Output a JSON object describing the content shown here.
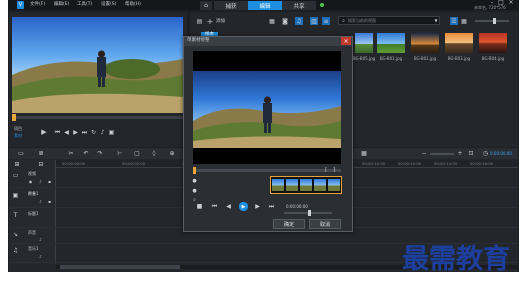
{
  "menu": {
    "items": [
      "文件(F)",
      "编辑(E)",
      "工具(T)",
      "设置(S)",
      "帮助(H)"
    ]
  },
  "window_title": "未命名, 720*576",
  "workspace_tabs": [
    {
      "label": "捕获",
      "active": false
    },
    {
      "label": "编辑",
      "active": true
    },
    {
      "label": "共享",
      "active": false
    }
  ],
  "library": {
    "add_label": "添加",
    "folder_label": "样本",
    "search_placeholder": "搜索当前的视图",
    "thumbnails": [
      "BG-B01.jpg",
      "BG-B02.jpg",
      "BG-B03.jpg",
      "BG-B04.jpg",
      "BG-B05.jpg"
    ]
  },
  "player": {
    "mode_labels": [
      "项目",
      "素材"
    ]
  },
  "dialog": {
    "title": "单素材修整",
    "trim_markers": [
      "[",
      "]"
    ],
    "timecode": "0:00:00:00",
    "ok_label": "确定",
    "cancel_label": "取消"
  },
  "timeline": {
    "timecode": "0:00:00:00",
    "zoom_label": "100%",
    "ruler": [
      "00:00:00:00",
      "00:00:02:00",
      "00:00:04:00",
      "00:00:06:00",
      "00:00:08:00",
      "00:00:10:00",
      "00:00:12:00",
      "00:00:14:00",
      "00:00:16:00"
    ],
    "tracks": [
      {
        "name": "视频",
        "icon": "video-track-icon"
      },
      {
        "name": "覆叠1",
        "icon": "overlay-track-icon"
      },
      {
        "name": "标题1",
        "icon": "title-track-icon"
      },
      {
        "name": "声音",
        "icon": "voice-track-icon"
      },
      {
        "name": "音乐1",
        "icon": "music-track-icon"
      }
    ]
  },
  "watermark": "最需教育",
  "colors": {
    "accent": "#1e8fe0",
    "panel": "#23262b",
    "dark": "#1a1d22",
    "watermark": "#1d3f9e"
  }
}
